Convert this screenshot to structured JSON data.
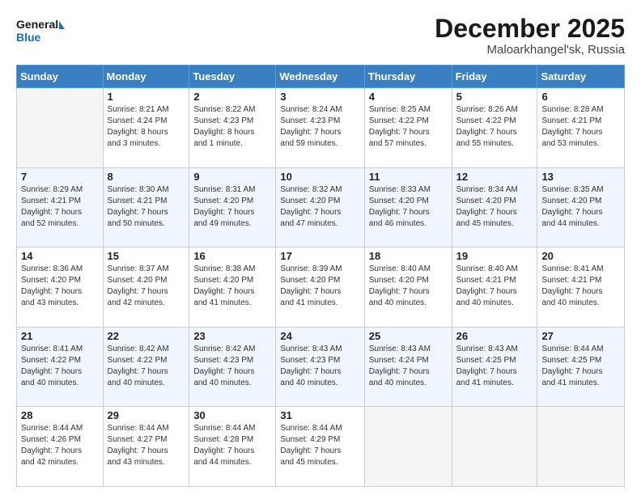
{
  "header": {
    "logo_line1": "General",
    "logo_line2": "Blue",
    "month": "December 2025",
    "location": "Maloarkhangel'sk, Russia"
  },
  "days_of_week": [
    "Sunday",
    "Monday",
    "Tuesday",
    "Wednesday",
    "Thursday",
    "Friday",
    "Saturday"
  ],
  "weeks": [
    [
      {
        "day": "",
        "info": ""
      },
      {
        "day": "1",
        "info": "Sunrise: 8:21 AM\nSunset: 4:24 PM\nDaylight: 8 hours\nand 3 minutes."
      },
      {
        "day": "2",
        "info": "Sunrise: 8:22 AM\nSunset: 4:23 PM\nDaylight: 8 hours\nand 1 minute."
      },
      {
        "day": "3",
        "info": "Sunrise: 8:24 AM\nSunset: 4:23 PM\nDaylight: 7 hours\nand 59 minutes."
      },
      {
        "day": "4",
        "info": "Sunrise: 8:25 AM\nSunset: 4:22 PM\nDaylight: 7 hours\nand 57 minutes."
      },
      {
        "day": "5",
        "info": "Sunrise: 8:26 AM\nSunset: 4:22 PM\nDaylight: 7 hours\nand 55 minutes."
      },
      {
        "day": "6",
        "info": "Sunrise: 8:28 AM\nSunset: 4:21 PM\nDaylight: 7 hours\nand 53 minutes."
      }
    ],
    [
      {
        "day": "7",
        "info": "Sunrise: 8:29 AM\nSunset: 4:21 PM\nDaylight: 7 hours\nand 52 minutes."
      },
      {
        "day": "8",
        "info": "Sunrise: 8:30 AM\nSunset: 4:21 PM\nDaylight: 7 hours\nand 50 minutes."
      },
      {
        "day": "9",
        "info": "Sunrise: 8:31 AM\nSunset: 4:20 PM\nDaylight: 7 hours\nand 49 minutes."
      },
      {
        "day": "10",
        "info": "Sunrise: 8:32 AM\nSunset: 4:20 PM\nDaylight: 7 hours\nand 47 minutes."
      },
      {
        "day": "11",
        "info": "Sunrise: 8:33 AM\nSunset: 4:20 PM\nDaylight: 7 hours\nand 46 minutes."
      },
      {
        "day": "12",
        "info": "Sunrise: 8:34 AM\nSunset: 4:20 PM\nDaylight: 7 hours\nand 45 minutes."
      },
      {
        "day": "13",
        "info": "Sunrise: 8:35 AM\nSunset: 4:20 PM\nDaylight: 7 hours\nand 44 minutes."
      }
    ],
    [
      {
        "day": "14",
        "info": "Sunrise: 8:36 AM\nSunset: 4:20 PM\nDaylight: 7 hours\nand 43 minutes."
      },
      {
        "day": "15",
        "info": "Sunrise: 8:37 AM\nSunset: 4:20 PM\nDaylight: 7 hours\nand 42 minutes."
      },
      {
        "day": "16",
        "info": "Sunrise: 8:38 AM\nSunset: 4:20 PM\nDaylight: 7 hours\nand 41 minutes."
      },
      {
        "day": "17",
        "info": "Sunrise: 8:39 AM\nSunset: 4:20 PM\nDaylight: 7 hours\nand 41 minutes."
      },
      {
        "day": "18",
        "info": "Sunrise: 8:40 AM\nSunset: 4:20 PM\nDaylight: 7 hours\nand 40 minutes."
      },
      {
        "day": "19",
        "info": "Sunrise: 8:40 AM\nSunset: 4:21 PM\nDaylight: 7 hours\nand 40 minutes."
      },
      {
        "day": "20",
        "info": "Sunrise: 8:41 AM\nSunset: 4:21 PM\nDaylight: 7 hours\nand 40 minutes."
      }
    ],
    [
      {
        "day": "21",
        "info": "Sunrise: 8:41 AM\nSunset: 4:22 PM\nDaylight: 7 hours\nand 40 minutes."
      },
      {
        "day": "22",
        "info": "Sunrise: 8:42 AM\nSunset: 4:22 PM\nDaylight: 7 hours\nand 40 minutes."
      },
      {
        "day": "23",
        "info": "Sunrise: 8:42 AM\nSunset: 4:23 PM\nDaylight: 7 hours\nand 40 minutes."
      },
      {
        "day": "24",
        "info": "Sunrise: 8:43 AM\nSunset: 4:23 PM\nDaylight: 7 hours\nand 40 minutes."
      },
      {
        "day": "25",
        "info": "Sunrise: 8:43 AM\nSunset: 4:24 PM\nDaylight: 7 hours\nand 40 minutes."
      },
      {
        "day": "26",
        "info": "Sunrise: 8:43 AM\nSunset: 4:25 PM\nDaylight: 7 hours\nand 41 minutes."
      },
      {
        "day": "27",
        "info": "Sunrise: 8:44 AM\nSunset: 4:25 PM\nDaylight: 7 hours\nand 41 minutes."
      }
    ],
    [
      {
        "day": "28",
        "info": "Sunrise: 8:44 AM\nSunset: 4:26 PM\nDaylight: 7 hours\nand 42 minutes."
      },
      {
        "day": "29",
        "info": "Sunrise: 8:44 AM\nSunset: 4:27 PM\nDaylight: 7 hours\nand 43 minutes."
      },
      {
        "day": "30",
        "info": "Sunrise: 8:44 AM\nSunset: 4:28 PM\nDaylight: 7 hours\nand 44 minutes."
      },
      {
        "day": "31",
        "info": "Sunrise: 8:44 AM\nSunset: 4:29 PM\nDaylight: 7 hours\nand 45 minutes."
      },
      {
        "day": "",
        "info": ""
      },
      {
        "day": "",
        "info": ""
      },
      {
        "day": "",
        "info": ""
      }
    ]
  ]
}
